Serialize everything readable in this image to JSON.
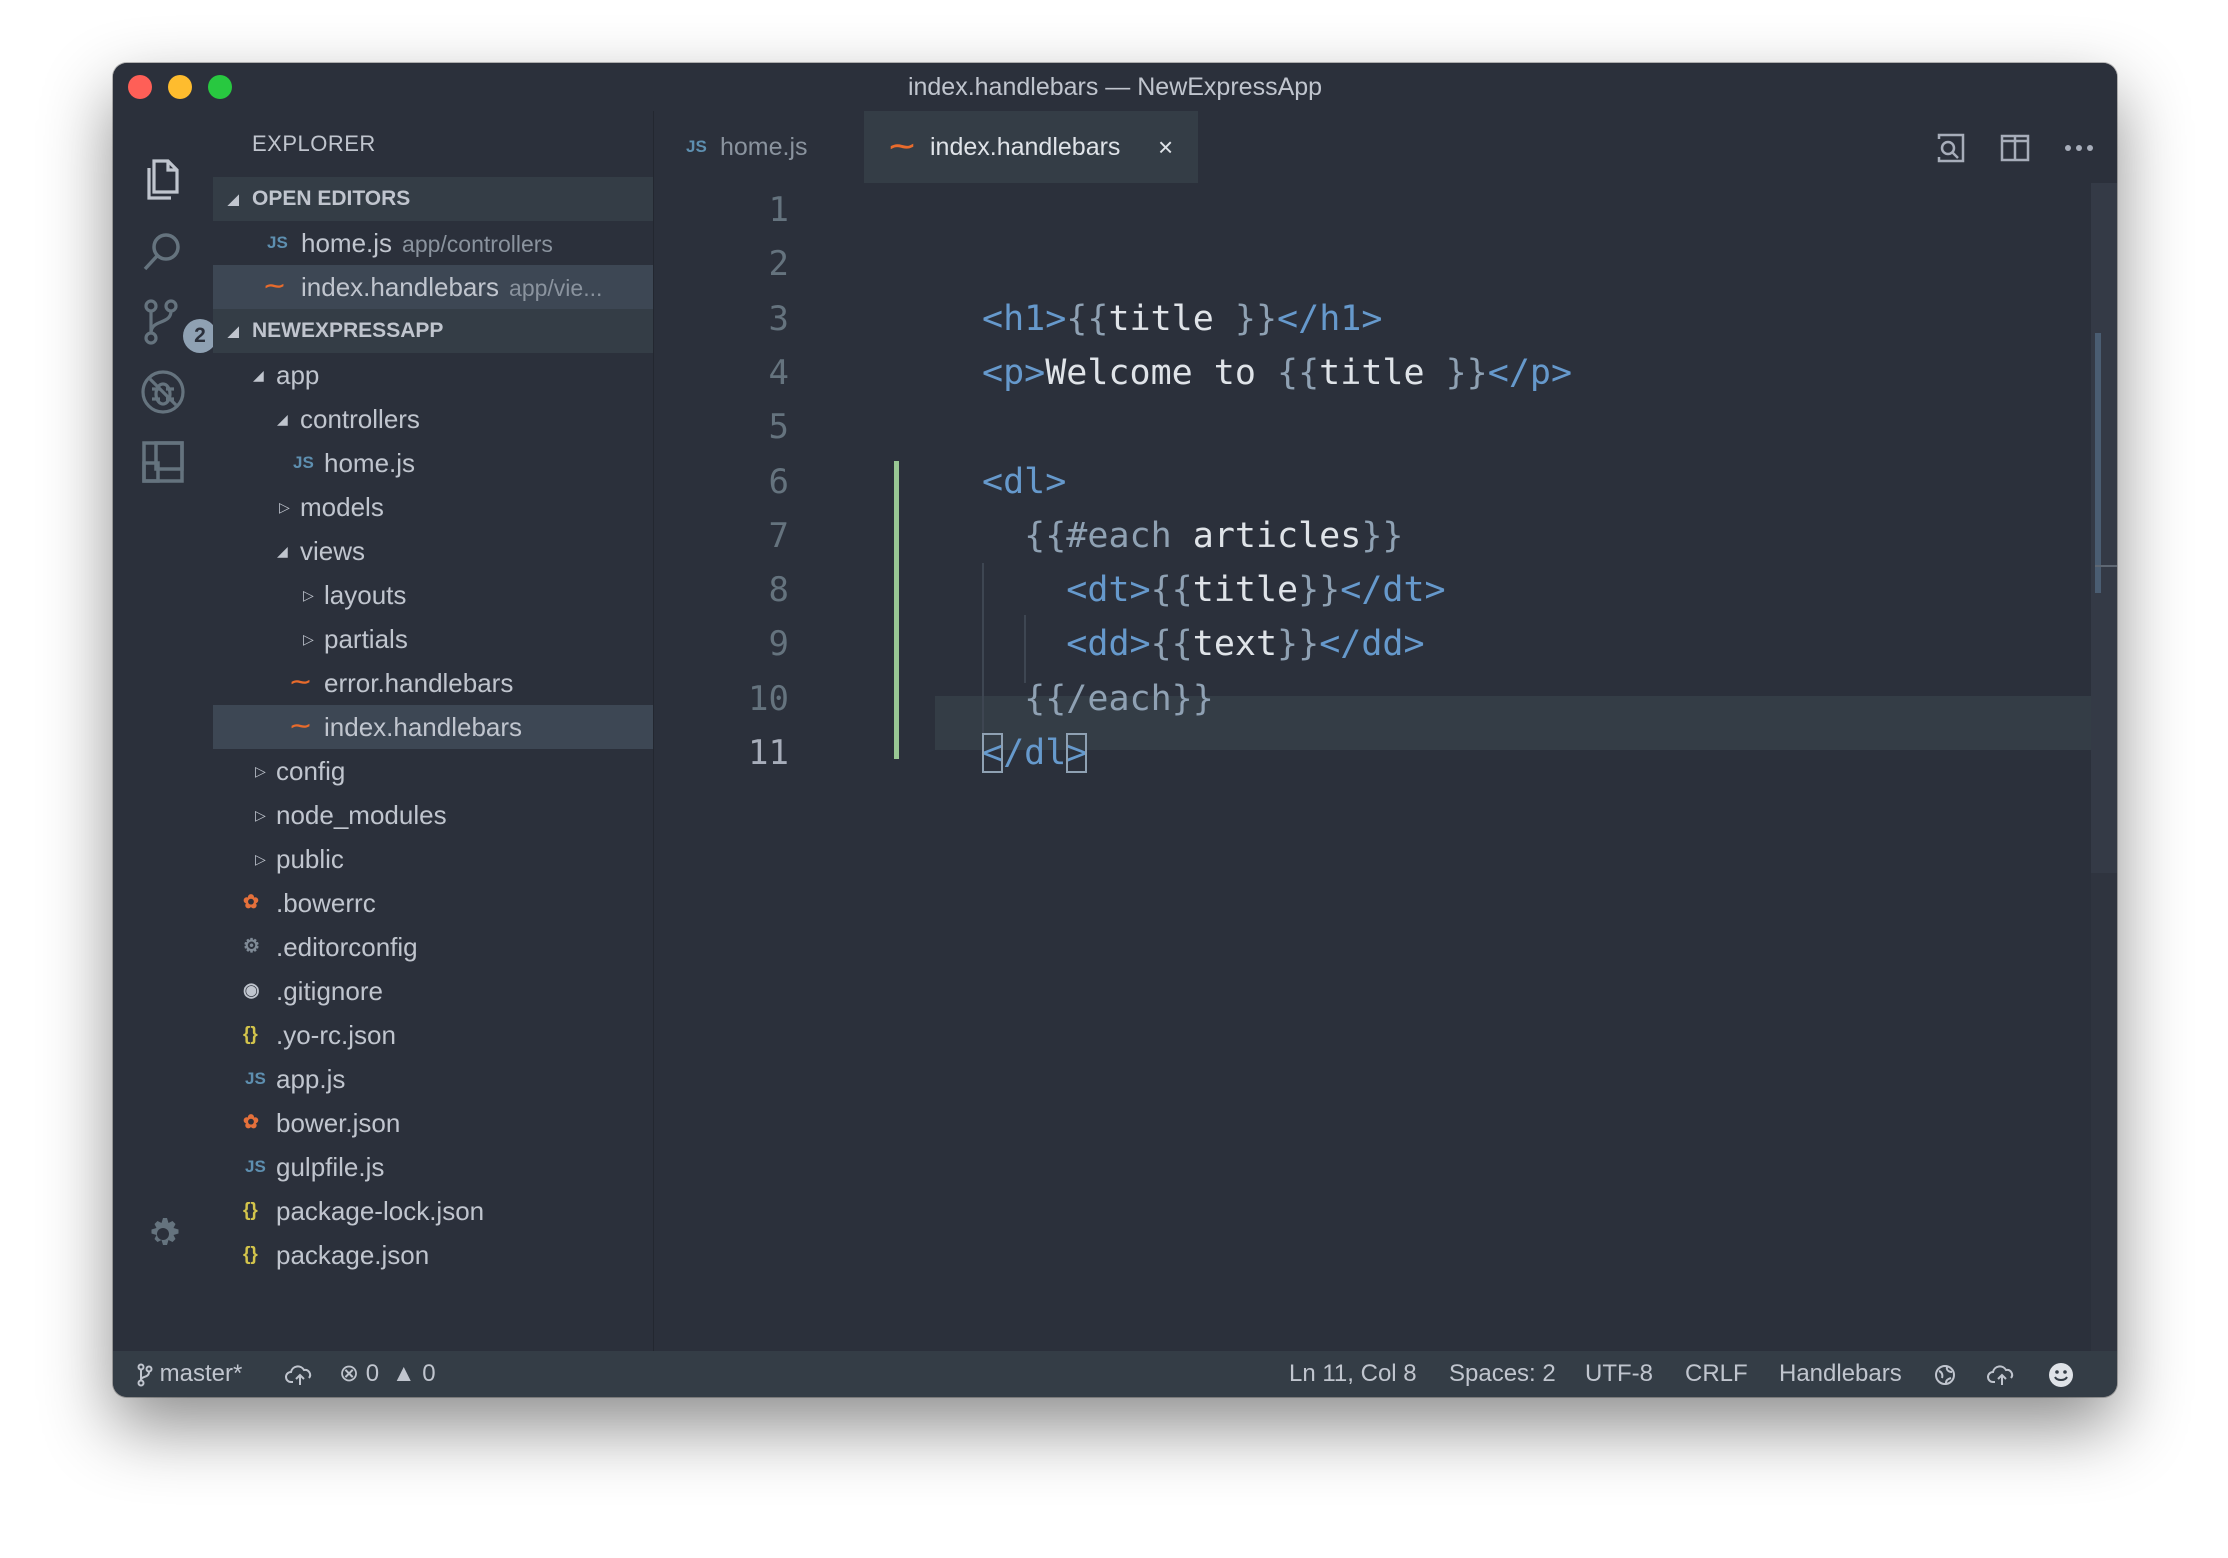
{
  "window": {
    "title": "index.handlebars — NewExpressApp"
  },
  "activity_bar": {
    "icons": [
      "files-icon",
      "search-icon",
      "source-control-icon",
      "debug-icon",
      "extensions-icon",
      "gear-icon"
    ],
    "source_control_badge": "2"
  },
  "explorer": {
    "title": "EXPLORER",
    "open_editors": {
      "header": "OPEN EDITORS",
      "items": [
        {
          "icon": "JS",
          "name": "home.js",
          "description": "app/controllers"
        },
        {
          "icon": "handlebars",
          "name": "index.handlebars",
          "description": "app/vie..."
        }
      ]
    },
    "project": {
      "header": "NEWEXPRESSAPP",
      "items": [
        {
          "name": "app"
        },
        {
          "name": "controllers"
        },
        {
          "icon": "JS",
          "name": "home.js"
        },
        {
          "name": "models"
        },
        {
          "name": "views"
        },
        {
          "name": "layouts"
        },
        {
          "name": "partials"
        },
        {
          "icon": "handlebars",
          "name": "error.handlebars"
        },
        {
          "icon": "handlebars",
          "name": "index.handlebars"
        },
        {
          "name": "config"
        },
        {
          "name": "node_modules"
        },
        {
          "name": "public"
        },
        {
          "icon": "bower",
          "name": ".bowerrc"
        },
        {
          "icon": "gear",
          "name": ".editorconfig"
        },
        {
          "icon": "git",
          "name": ".gitignore"
        },
        {
          "icon": "{}",
          "name": ".yo-rc.json"
        },
        {
          "icon": "JS",
          "name": "app.js"
        },
        {
          "icon": "bower",
          "name": "bower.json"
        },
        {
          "icon": "JS",
          "name": "gulpfile.js"
        },
        {
          "icon": "{}",
          "name": "package-lock.json"
        },
        {
          "icon": "{}",
          "name": "package.json"
        }
      ]
    }
  },
  "tabs": [
    {
      "icon": "JS",
      "name": "home.js",
      "active": false
    },
    {
      "icon": "handlebars",
      "name": "index.handlebars",
      "active": true,
      "close": "×"
    }
  ],
  "editor": {
    "line_numbers": [
      "1",
      "2",
      "3",
      "4",
      "5",
      "6",
      "7",
      "8",
      "9",
      "10",
      "11"
    ],
    "code": [
      [],
      [],
      [
        {
          "t": "<h1>",
          "c": "tag"
        },
        {
          "t": "{{",
          "c": "mus"
        },
        {
          "t": "title ",
          "c": "txt"
        },
        {
          "t": "}}",
          "c": "mus"
        },
        {
          "t": "</h1>",
          "c": "tag"
        }
      ],
      [
        {
          "t": "<p>",
          "c": "tag"
        },
        {
          "t": "Welcome to ",
          "c": "txt"
        },
        {
          "t": "{{",
          "c": "mus"
        },
        {
          "t": "title ",
          "c": "txt"
        },
        {
          "t": "}}",
          "c": "mus"
        },
        {
          "t": "</p>",
          "c": "tag"
        }
      ],
      [],
      [
        {
          "t": "<dl>",
          "c": "tag"
        }
      ],
      [
        {
          "t": "  ",
          "c": "txt"
        },
        {
          "t": "{{#each",
          "c": "mus"
        },
        {
          "t": " articles",
          "c": "txt"
        },
        {
          "t": "}}",
          "c": "mus"
        }
      ],
      [
        {
          "t": "    ",
          "c": "txt"
        },
        {
          "t": "<dt>",
          "c": "tag"
        },
        {
          "t": "{{",
          "c": "mus"
        },
        {
          "t": "title",
          "c": "txt"
        },
        {
          "t": "}}",
          "c": "mus"
        },
        {
          "t": "</dt>",
          "c": "tag"
        }
      ],
      [
        {
          "t": "    ",
          "c": "txt"
        },
        {
          "t": "<dd>",
          "c": "tag"
        },
        {
          "t": "{{",
          "c": "mus"
        },
        {
          "t": "text",
          "c": "txt"
        },
        {
          "t": "}}",
          "c": "mus"
        },
        {
          "t": "</dd>",
          "c": "tag"
        }
      ],
      [
        {
          "t": "  ",
          "c": "txt"
        },
        {
          "t": "{{/each}}",
          "c": "mus"
        }
      ],
      [
        {
          "t": "<",
          "c": "tag bracket-box"
        },
        {
          "t": "/dl",
          "c": "tag"
        },
        {
          "t": ">",
          "c": "tag bracket-box"
        }
      ]
    ]
  },
  "statusbar": {
    "branch": "master*",
    "errors": "0",
    "warnings": "0",
    "cursor": "Ln 11, Col 8",
    "spaces": "Spaces: 2",
    "encoding": "UTF-8",
    "eol": "CRLF",
    "language": "Handlebars"
  },
  "colors": {
    "background": "#2b303b",
    "tag": "#6699cc",
    "mustache": "#8fa1b3",
    "text": "#dfe3e8",
    "handlebars_icon": "#e86b2c",
    "json_icon": "#d3c44b",
    "diff_added": "#99c794"
  }
}
